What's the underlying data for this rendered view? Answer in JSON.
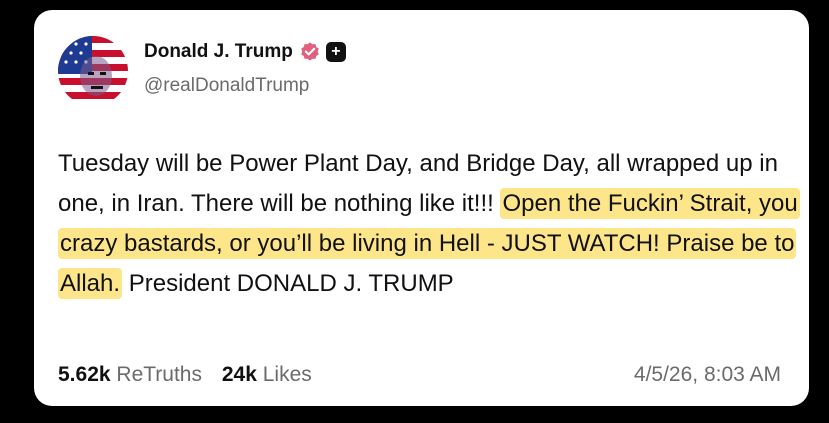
{
  "author": {
    "display_name": "Donald J. Trump",
    "handle": "@realDonaldTrump",
    "avatar_icon": "flag-face-avatar",
    "verified_icon": "verified-badge-icon",
    "badge_label": "+"
  },
  "post": {
    "text_before": "Tuesday will be Power Plant Day, and Bridge Day, all wrapped up in one, in Iran. There will be nothing like it!!! ",
    "text_highlighted": "Open the Fuckin’ Strait, you crazy bastards, or you’ll be living in Hell - JUST WATCH! Praise be to Allah.",
    "text_after": " President DONALD J. TRUMP",
    "highlight_color": "#fde68a"
  },
  "stats": {
    "retruths_count": "5.62k",
    "retruths_label": "ReTruths",
    "likes_count": "24k",
    "likes_label": "Likes"
  },
  "timestamp": "4/5/26, 8:03 AM",
  "colors": {
    "background": "#000000",
    "card": "#ffffff",
    "verified": "#e0607e",
    "text": "#111111",
    "muted": "#6b6b6b"
  }
}
